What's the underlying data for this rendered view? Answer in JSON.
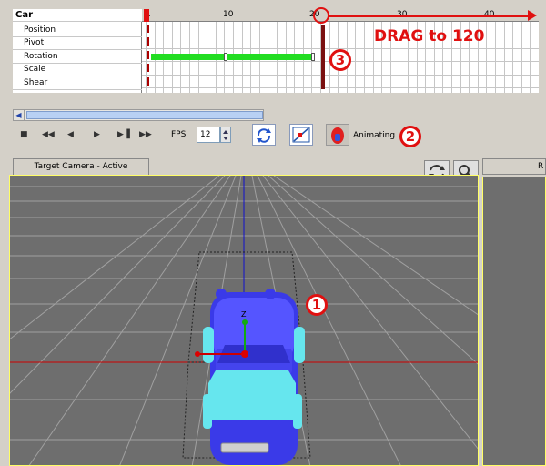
{
  "timeline": {
    "object_name": "Car",
    "tracks": [
      "Position",
      "Pivot",
      "Rotation",
      "Scale",
      "Shear"
    ],
    "ruler_ticks": [
      "1",
      "10",
      "20",
      "30",
      "40"
    ]
  },
  "annotations": {
    "drag_text": "DRAG to 120",
    "callout_1": "1",
    "callout_2": "2",
    "callout_3": "3"
  },
  "transport": {
    "buttons": [
      "stop",
      "go-to-start",
      "step-back",
      "play",
      "step-forward",
      "go-to-end"
    ],
    "fps_label": "FPS",
    "fps_value": "12",
    "animating_label": "Animating"
  },
  "viewport": {
    "tab_label": "Target Camera - Active",
    "right_tab_label": "R",
    "axis_label": "Z"
  },
  "colors": {
    "annotation_red": "#e01010",
    "track_green": "#22dd22",
    "car_blue": "#3a3ae8",
    "car_cyan": "#66e6ee",
    "viewport_gray": "#6e6e6e"
  }
}
